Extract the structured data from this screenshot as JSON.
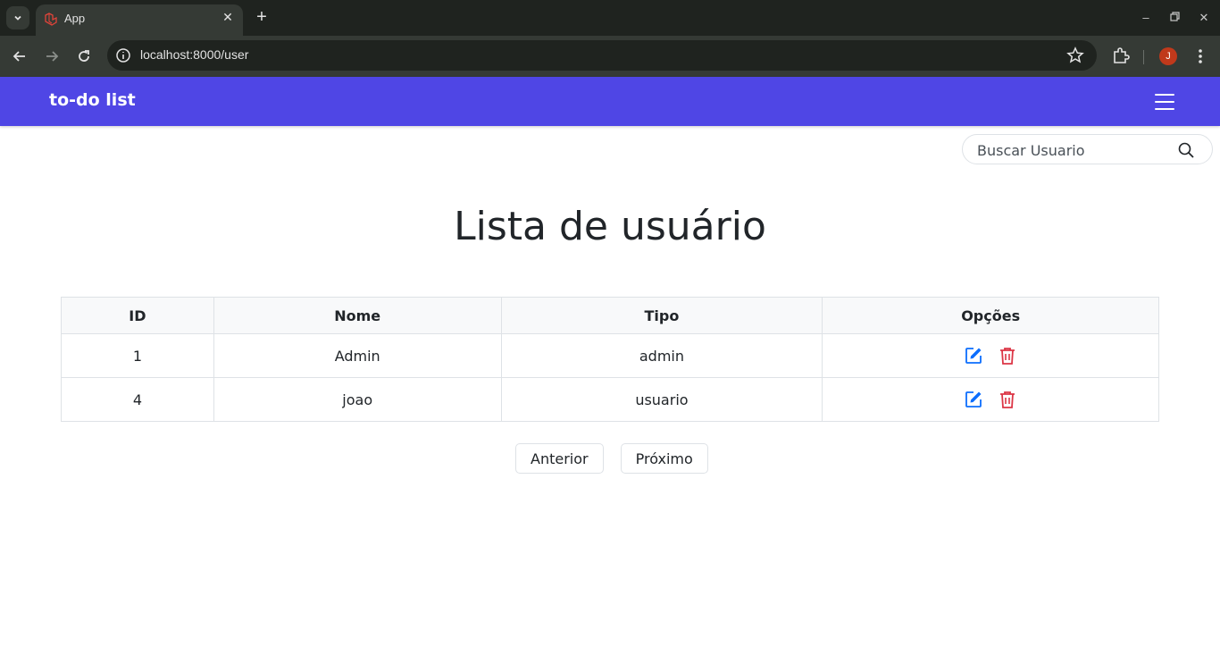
{
  "browser": {
    "tab_title": "App",
    "url": "localhost:8000/user",
    "profile_initial": "J"
  },
  "app": {
    "brand": "to-do list",
    "accent_color": "#4f46e5"
  },
  "search": {
    "placeholder": "Buscar Usuario"
  },
  "page": {
    "title": "Lista de usuário"
  },
  "table": {
    "headers": [
      "ID",
      "Nome",
      "Tipo",
      "Opções"
    ],
    "rows": [
      {
        "id": "1",
        "nome": "Admin",
        "tipo": "admin"
      },
      {
        "id": "4",
        "nome": "joao",
        "tipo": "usuario"
      }
    ],
    "edit_color": "#0d6efd",
    "delete_color": "#dc3545"
  },
  "pagination": {
    "prev_label": "Anterior",
    "next_label": "Próximo"
  }
}
